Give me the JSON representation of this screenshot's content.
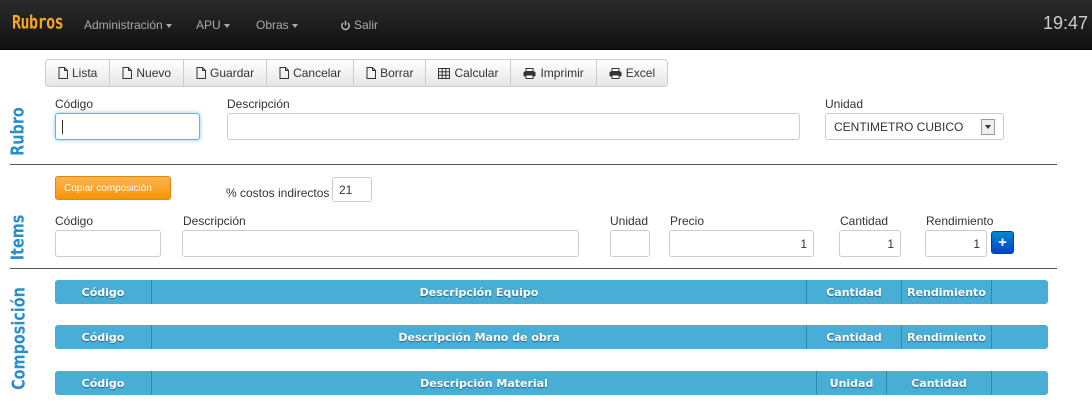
{
  "navbar": {
    "brand": "Rubros",
    "menu": [
      {
        "label": "Administración"
      },
      {
        "label": "APU"
      },
      {
        "label": "Obras"
      }
    ],
    "logout": "Salir",
    "clock": "19:47"
  },
  "toolbar": {
    "buttons": [
      {
        "label": "Lista",
        "icon": "file-icon"
      },
      {
        "label": "Nuevo",
        "icon": "file-icon"
      },
      {
        "label": "Guardar",
        "icon": "file-icon"
      },
      {
        "label": "Cancelar",
        "icon": "file-icon"
      },
      {
        "label": "Borrar",
        "icon": "file-icon"
      },
      {
        "label": "Calcular",
        "icon": "table-icon"
      },
      {
        "label": "Imprimir",
        "icon": "print-icon"
      },
      {
        "label": "Excel",
        "icon": "print-icon"
      }
    ]
  },
  "rubro": {
    "section_label": "Rubro",
    "codigo_label": "Código",
    "codigo_value": "",
    "descripcion_label": "Descripción",
    "descripcion_value": "",
    "unidad_label": "Unidad",
    "unidad_value": "CENTIMETRO CUBICO"
  },
  "items": {
    "section_label": "Items",
    "copy_button": "Copiar composición",
    "indirect_label": "% costos indirectos",
    "indirect_value": "21",
    "codigo_label": "Código",
    "descripcion_label": "Descripción",
    "unidad_label": "Unidad",
    "precio_label": "Precio",
    "precio_value": "1",
    "cantidad_label": "Cantidad",
    "cantidad_value": "1",
    "rendimiento_label": "Rendimiento",
    "rendimiento_value": "1",
    "add_button": "+"
  },
  "composicion": {
    "section_label": "Composición",
    "tables": [
      {
        "columns": [
          "Código",
          "Descripción Equipo",
          "Cantidad",
          "Rendimiento",
          ""
        ]
      },
      {
        "columns": [
          "Código",
          "Descripción Mano de obra",
          "Cantidad",
          "Rendimiento",
          ""
        ]
      },
      {
        "columns": [
          "Código",
          "Descripción Material",
          "Unidad",
          "Cantidad",
          ""
        ]
      }
    ]
  },
  "colors": {
    "brand": "#f5a623",
    "section_label": "#2a8ec9",
    "table_header": "#49aed6",
    "copy_button": "#f89406",
    "add_button": "#0055cc"
  }
}
